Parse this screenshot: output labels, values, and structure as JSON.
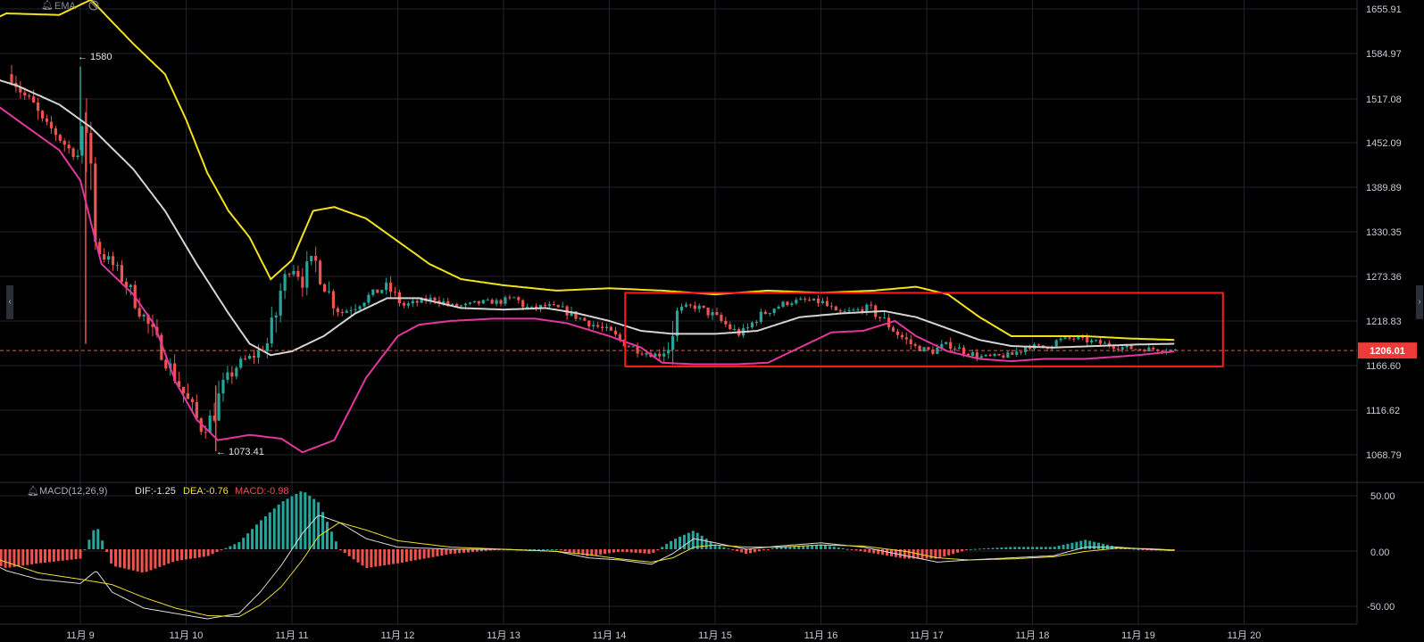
{
  "colors": {
    "background": "#000000",
    "grid": "#1f232b",
    "axis_text": "#c9ccd4",
    "candle_up": "#26a69a",
    "candle_down": "#ef5350",
    "band_upper": "#f2e21a",
    "band_middle": "#d4d4d4",
    "band_lower": "#e3379f",
    "price_line": "#ef5350",
    "highlight_box": "#ff1a1a",
    "macd_dif": "#dcdcdc",
    "macd_dea": "#f0e030",
    "hist_up": "#26a69a",
    "hist_down": "#ef5350"
  },
  "main_indicator": {
    "name": "EMA"
  },
  "price_axis": {
    "ticks": [
      "1655.91",
      "1584.97",
      "1517.08",
      "1452.09",
      "1389.89",
      "1330.35",
      "1273.36",
      "1218.83",
      "1166.60",
      "1116.62",
      "1068.79"
    ]
  },
  "current_price": {
    "label": "1206.01",
    "value": 1206.01
  },
  "annotations": {
    "high": "← 1580",
    "low": "← 1073.41"
  },
  "macd": {
    "title": "MACD(12,26,9)",
    "dif_label": "DIF:-1.25",
    "dea_label": "DEA:-0.76",
    "macd_label": "MACD:-0.98",
    "axis_ticks": [
      "50.00",
      "0.00",
      "-50.00"
    ]
  },
  "time_axis": {
    "labels": [
      "11月 9",
      "11月 10",
      "11月 11",
      "11月 12",
      "11月 13",
      "11月 14",
      "11月 15",
      "11月 16",
      "11月 17",
      "11月 18",
      "11月 19",
      "11月 20"
    ]
  },
  "chart_data": {
    "type": "candlestick",
    "x_range": [
      "11月 8",
      "11月 20"
    ],
    "y_range": [
      1040,
      1670
    ],
    "grid": true,
    "close_path": [
      [
        8.35,
        1570
      ],
      [
        8.45,
        1545
      ],
      [
        8.55,
        1530
      ],
      [
        8.65,
        1505
      ],
      [
        8.75,
        1495
      ],
      [
        8.9,
        1470
      ],
      [
        9.0,
        1460
      ],
      [
        9.05,
        1520
      ],
      [
        9.1,
        1450
      ],
      [
        9.15,
        1340
      ],
      [
        9.3,
        1320
      ],
      [
        9.45,
        1290
      ],
      [
        9.6,
        1250
      ],
      [
        9.75,
        1210
      ],
      [
        9.9,
        1170
      ],
      [
        10.05,
        1130
      ],
      [
        10.15,
        1100
      ],
      [
        10.25,
        1120
      ],
      [
        10.35,
        1160
      ],
      [
        10.5,
        1190
      ],
      [
        10.65,
        1200
      ],
      [
        10.8,
        1220
      ],
      [
        10.9,
        1290
      ],
      [
        11.0,
        1320
      ],
      [
        11.1,
        1300
      ],
      [
        11.2,
        1330
      ],
      [
        11.3,
        1295
      ],
      [
        11.45,
        1255
      ],
      [
        11.6,
        1265
      ],
      [
        11.75,
        1280
      ],
      [
        11.9,
        1290
      ],
      [
        12.05,
        1265
      ],
      [
        12.2,
        1270
      ],
      [
        12.35,
        1275
      ],
      [
        12.5,
        1265
      ],
      [
        12.65,
        1265
      ],
      [
        12.8,
        1270
      ],
      [
        12.95,
        1270
      ],
      [
        13.1,
        1275
      ],
      [
        13.25,
        1260
      ],
      [
        13.4,
        1265
      ],
      [
        13.55,
        1260
      ],
      [
        13.7,
        1250
      ],
      [
        13.85,
        1240
      ],
      [
        14.0,
        1230
      ],
      [
        14.15,
        1215
      ],
      [
        14.3,
        1205
      ],
      [
        14.45,
        1200
      ],
      [
        14.55,
        1210
      ],
      [
        14.65,
        1260
      ],
      [
        14.8,
        1265
      ],
      [
        14.95,
        1255
      ],
      [
        15.1,
        1240
      ],
      [
        15.25,
        1225
      ],
      [
        15.4,
        1250
      ],
      [
        15.55,
        1262
      ],
      [
        15.7,
        1270
      ],
      [
        15.85,
        1272
      ],
      [
        16.0,
        1270
      ],
      [
        16.15,
        1255
      ],
      [
        16.3,
        1258
      ],
      [
        16.45,
        1262
      ],
      [
        16.6,
        1245
      ],
      [
        16.75,
        1225
      ],
      [
        16.9,
        1210
      ],
      [
        17.05,
        1205
      ],
      [
        17.2,
        1215
      ],
      [
        17.35,
        1205
      ],
      [
        17.5,
        1198
      ],
      [
        17.65,
        1198
      ],
      [
        17.8,
        1200
      ],
      [
        17.95,
        1212
      ],
      [
        18.1,
        1210
      ],
      [
        18.25,
        1220
      ],
      [
        18.4,
        1222
      ],
      [
        18.55,
        1218
      ],
      [
        18.7,
        1214
      ],
      [
        18.85,
        1210
      ],
      [
        19.0,
        1208
      ],
      [
        19.2,
        1208
      ],
      [
        19.35,
        1206
      ]
    ],
    "ema_band": {
      "upper": [
        [
          8.0,
          1630
        ],
        [
          8.3,
          1650
        ],
        [
          8.8,
          1648
        ],
        [
          9.1,
          1668
        ],
        [
          9.5,
          1610
        ],
        [
          9.8,
          1570
        ],
        [
          10.0,
          1510
        ],
        [
          10.2,
          1440
        ],
        [
          10.4,
          1390
        ],
        [
          10.6,
          1355
        ],
        [
          10.8,
          1300
        ],
        [
          11.0,
          1325
        ],
        [
          11.2,
          1390
        ],
        [
          11.4,
          1395
        ],
        [
          11.7,
          1380
        ],
        [
          12.0,
          1350
        ],
        [
          12.3,
          1320
        ],
        [
          12.6,
          1300
        ],
        [
          13.0,
          1292
        ],
        [
          13.5,
          1285
        ],
        [
          14.0,
          1288
        ],
        [
          14.5,
          1285
        ],
        [
          15.0,
          1280
        ],
        [
          15.5,
          1285
        ],
        [
          16.0,
          1282
        ],
        [
          16.5,
          1285
        ],
        [
          16.9,
          1290
        ],
        [
          17.2,
          1280
        ],
        [
          17.5,
          1250
        ],
        [
          17.8,
          1225
        ],
        [
          18.1,
          1225
        ],
        [
          18.5,
          1225
        ],
        [
          18.9,
          1222
        ],
        [
          19.35,
          1220
        ]
      ],
      "middle": [
        [
          8.0,
          1572
        ],
        [
          8.4,
          1555
        ],
        [
          8.8,
          1530
        ],
        [
          9.1,
          1500
        ],
        [
          9.5,
          1445
        ],
        [
          9.8,
          1390
        ],
        [
          10.1,
          1320
        ],
        [
          10.4,
          1255
        ],
        [
          10.6,
          1215
        ],
        [
          10.8,
          1200
        ],
        [
          11.0,
          1205
        ],
        [
          11.3,
          1225
        ],
        [
          11.6,
          1255
        ],
        [
          11.9,
          1275
        ],
        [
          12.2,
          1275
        ],
        [
          12.6,
          1262
        ],
        [
          13.0,
          1260
        ],
        [
          13.4,
          1262
        ],
        [
          13.7,
          1255
        ],
        [
          14.0,
          1245
        ],
        [
          14.3,
          1232
        ],
        [
          14.6,
          1228
        ],
        [
          15.0,
          1228
        ],
        [
          15.4,
          1232
        ],
        [
          15.8,
          1250
        ],
        [
          16.2,
          1255
        ],
        [
          16.6,
          1258
        ],
        [
          16.9,
          1250
        ],
        [
          17.2,
          1235
        ],
        [
          17.5,
          1220
        ],
        [
          17.8,
          1212
        ],
        [
          18.2,
          1210
        ],
        [
          18.6,
          1212
        ],
        [
          19.0,
          1214
        ],
        [
          19.35,
          1215
        ]
      ],
      "lower": [
        [
          8.0,
          1550
        ],
        [
          8.4,
          1510
        ],
        [
          8.8,
          1470
        ],
        [
          9.0,
          1430
        ],
        [
          9.2,
          1320
        ],
        [
          9.5,
          1280
        ],
        [
          9.7,
          1240
        ],
        [
          9.9,
          1165
        ],
        [
          10.1,
          1115
        ],
        [
          10.3,
          1088
        ],
        [
          10.6,
          1095
        ],
        [
          10.9,
          1090
        ],
        [
          11.1,
          1072
        ],
        [
          11.4,
          1088
        ],
        [
          11.7,
          1170
        ],
        [
          12.0,
          1225
        ],
        [
          12.2,
          1240
        ],
        [
          12.5,
          1245
        ],
        [
          12.9,
          1248
        ],
        [
          13.3,
          1248
        ],
        [
          13.6,
          1242
        ],
        [
          14.0,
          1225
        ],
        [
          14.3,
          1210
        ],
        [
          14.5,
          1190
        ],
        [
          14.8,
          1188
        ],
        [
          15.2,
          1188
        ],
        [
          15.5,
          1190
        ],
        [
          15.8,
          1210
        ],
        [
          16.1,
          1230
        ],
        [
          16.4,
          1232
        ],
        [
          16.7,
          1245
        ],
        [
          16.9,
          1225
        ],
        [
          17.2,
          1205
        ],
        [
          17.5,
          1195
        ],
        [
          17.8,
          1192
        ],
        [
          18.1,
          1195
        ],
        [
          18.5,
          1195
        ],
        [
          18.8,
          1198
        ],
        [
          19.0,
          1200
        ],
        [
          19.35,
          1205
        ]
      ]
    },
    "highlight_region": {
      "x": [
        14.15,
        19.8
      ],
      "y": [
        1185,
        1282
      ]
    },
    "macd_range": [
      -70,
      62
    ],
    "macd_series": {
      "dif": [
        [
          8.0,
          -5
        ],
        [
          8.3,
          -20
        ],
        [
          8.6,
          -28
        ],
        [
          9.0,
          -32
        ],
        [
          9.15,
          -20
        ],
        [
          9.3,
          -40
        ],
        [
          9.6,
          -55
        ],
        [
          9.9,
          -60
        ],
        [
          10.2,
          -65
        ],
        [
          10.5,
          -60
        ],
        [
          10.7,
          -40
        ],
        [
          10.9,
          -15
        ],
        [
          11.1,
          15
        ],
        [
          11.25,
          32
        ],
        [
          11.45,
          25
        ],
        [
          11.7,
          10
        ],
        [
          12.0,
          2
        ],
        [
          12.5,
          0
        ],
        [
          13.0,
          0
        ],
        [
          13.5,
          -2
        ],
        [
          13.8,
          -8
        ],
        [
          14.1,
          -10
        ],
        [
          14.4,
          -14
        ],
        [
          14.6,
          -4
        ],
        [
          14.8,
          10
        ],
        [
          15.0,
          6
        ],
        [
          15.3,
          0
        ],
        [
          15.6,
          3
        ],
        [
          16.0,
          6
        ],
        [
          16.4,
          2
        ],
        [
          16.8,
          -6
        ],
        [
          17.1,
          -12
        ],
        [
          17.4,
          -10
        ],
        [
          17.8,
          -8
        ],
        [
          18.2,
          -6
        ],
        [
          18.5,
          2
        ],
        [
          18.8,
          2
        ],
        [
          19.1,
          0
        ],
        [
          19.35,
          -1.25
        ]
      ],
      "dea": [
        [
          8.0,
          -2
        ],
        [
          8.3,
          -12
        ],
        [
          8.6,
          -22
        ],
        [
          9.0,
          -28
        ],
        [
          9.3,
          -33
        ],
        [
          9.6,
          -45
        ],
        [
          9.9,
          -55
        ],
        [
          10.2,
          -62
        ],
        [
          10.5,
          -63
        ],
        [
          10.7,
          -52
        ],
        [
          10.9,
          -35
        ],
        [
          11.1,
          -10
        ],
        [
          11.25,
          12
        ],
        [
          11.45,
          25
        ],
        [
          11.7,
          18
        ],
        [
          12.0,
          8
        ],
        [
          12.5,
          2
        ],
        [
          13.0,
          0
        ],
        [
          13.5,
          -2
        ],
        [
          13.8,
          -5
        ],
        [
          14.1,
          -9
        ],
        [
          14.4,
          -12
        ],
        [
          14.6,
          -8
        ],
        [
          14.8,
          2
        ],
        [
          15.0,
          4
        ],
        [
          15.3,
          2
        ],
        [
          15.6,
          2
        ],
        [
          16.0,
          4
        ],
        [
          16.4,
          3
        ],
        [
          16.8,
          -2
        ],
        [
          17.1,
          -8
        ],
        [
          17.4,
          -10
        ],
        [
          17.8,
          -9
        ],
        [
          18.2,
          -7
        ],
        [
          18.5,
          -2
        ],
        [
          18.8,
          1
        ],
        [
          19.1,
          0.5
        ],
        [
          19.35,
          -0.76
        ]
      ]
    }
  }
}
